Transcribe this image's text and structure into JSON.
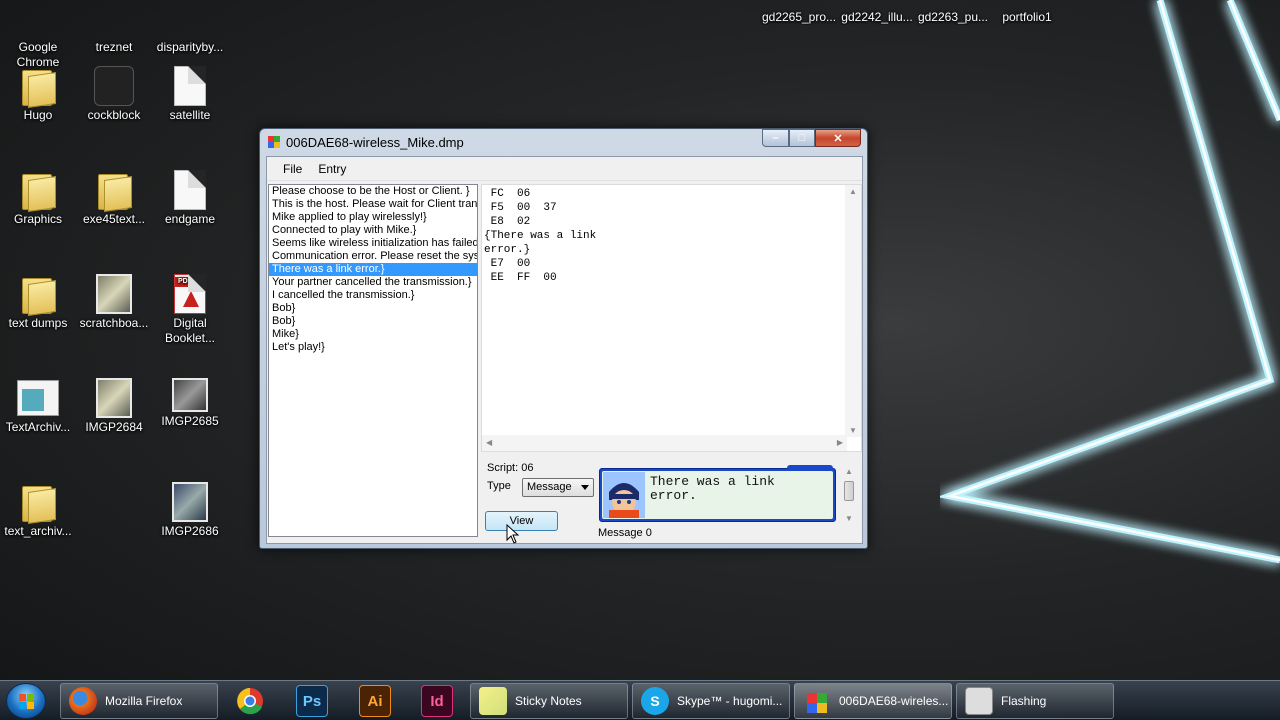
{
  "desktop": {
    "icons_left": [
      {
        "label": "Google Chrome",
        "line1": "Google",
        "line2": "Chrome",
        "kind": "chrome"
      },
      {
        "label": "treznet",
        "line1": "treznet",
        "kind": "folder"
      },
      {
        "label": "disparityby...",
        "line1": "disparityby...",
        "kind": "folder"
      },
      {
        "label": "Hugo",
        "line1": "Hugo",
        "kind": "folder"
      },
      {
        "label": "cockblock",
        "line1": "cockblock",
        "kind": "image"
      },
      {
        "label": "satellite",
        "line1": "satellite",
        "kind": "doc"
      },
      {
        "label": "Graphics",
        "line1": "Graphics",
        "kind": "folder"
      },
      {
        "label": "exe45text...",
        "line1": "exe45text...",
        "kind": "folder"
      },
      {
        "label": "endgame",
        "line1": "endgame",
        "kind": "doc"
      },
      {
        "label": "text dumps",
        "line1": "text dumps",
        "kind": "folder"
      },
      {
        "label": "scratchboa...",
        "line1": "scratchboa...",
        "kind": "image"
      },
      {
        "label": "Digital Booklet...",
        "line1": "Digital",
        "line2": "Booklet...",
        "kind": "pdf"
      },
      {
        "label": "TextArchiv...",
        "line1": "TextArchiv...",
        "kind": "app"
      },
      {
        "label": "IMGP2684",
        "line1": "IMGP2684",
        "kind": "image"
      },
      {
        "label": "IMGP2685",
        "line1": "IMGP2685",
        "kind": "image"
      },
      {
        "label": "text_archiv...",
        "line1": "text_archiv...",
        "kind": "folder"
      },
      {
        "label": "IMGP2686",
        "line1": "IMGP2686",
        "kind": "image"
      }
    ],
    "icons_top_right": [
      {
        "label": "gd2265_pro..."
      },
      {
        "label": "gd2242_illu..."
      },
      {
        "label": "gd2263_pu..."
      },
      {
        "label": "portfolio1"
      }
    ]
  },
  "window": {
    "title": "006DAE68-wireless_Mike.dmp",
    "buttons": {
      "minimize": "–",
      "maximize": "□",
      "close": "✕"
    },
    "menu": [
      "File",
      "Entry"
    ],
    "entries": [
      "Please choose to be the Host or Client. }",
      "This is the host. Please wait for Client transmission",
      "Mike applied to play wirelessly!}",
      "Connected to play with Mike.}",
      "Seems like wireless initialization has failed...",
      "Communication error. Please reset the system",
      "There was a link error.}",
      "Your partner cancelled the transmission.}",
      "I cancelled the transmission.}",
      "Bob}",
      "Bob}",
      "Mike}",
      "Let's play!}"
    ],
    "selected_entry_index": 6,
    "script_lines": [
      " FC  06",
      " F5  00  37",
      " E8  02",
      "{There was a link",
      "error.}",
      " E7  00",
      " EE  FF  00"
    ],
    "script_label": "Script: 06",
    "type_label": "Type",
    "type_value": "Message",
    "view_button": "View",
    "preview_text_line1": "There was a link",
    "preview_text_line2": "error.",
    "message_label": "Message 0"
  },
  "taskbar": {
    "items": [
      {
        "label": "Mozilla Firefox",
        "icon": "firefox-icon"
      },
      {
        "label": "",
        "icon": "chrome-icon"
      },
      {
        "label": "Ps",
        "icon": "photoshop-icon"
      },
      {
        "label": "Ai",
        "icon": "illustrator-icon"
      },
      {
        "label": "Id",
        "icon": "indesign-icon"
      },
      {
        "label": "Sticky Notes",
        "icon": "sticky-notes-icon"
      },
      {
        "label": "Skype™ - hugomi...",
        "icon": "skype-icon"
      },
      {
        "label": "006DAE68-wireles...",
        "icon": "app-icon"
      },
      {
        "label": "Flashing",
        "icon": "video-icon"
      }
    ]
  },
  "colors": {
    "selection": "#3399ff",
    "preview_border": "#1a48c8",
    "preview_bg": "#e8f4e8",
    "star_glow": "#bff3ff"
  }
}
